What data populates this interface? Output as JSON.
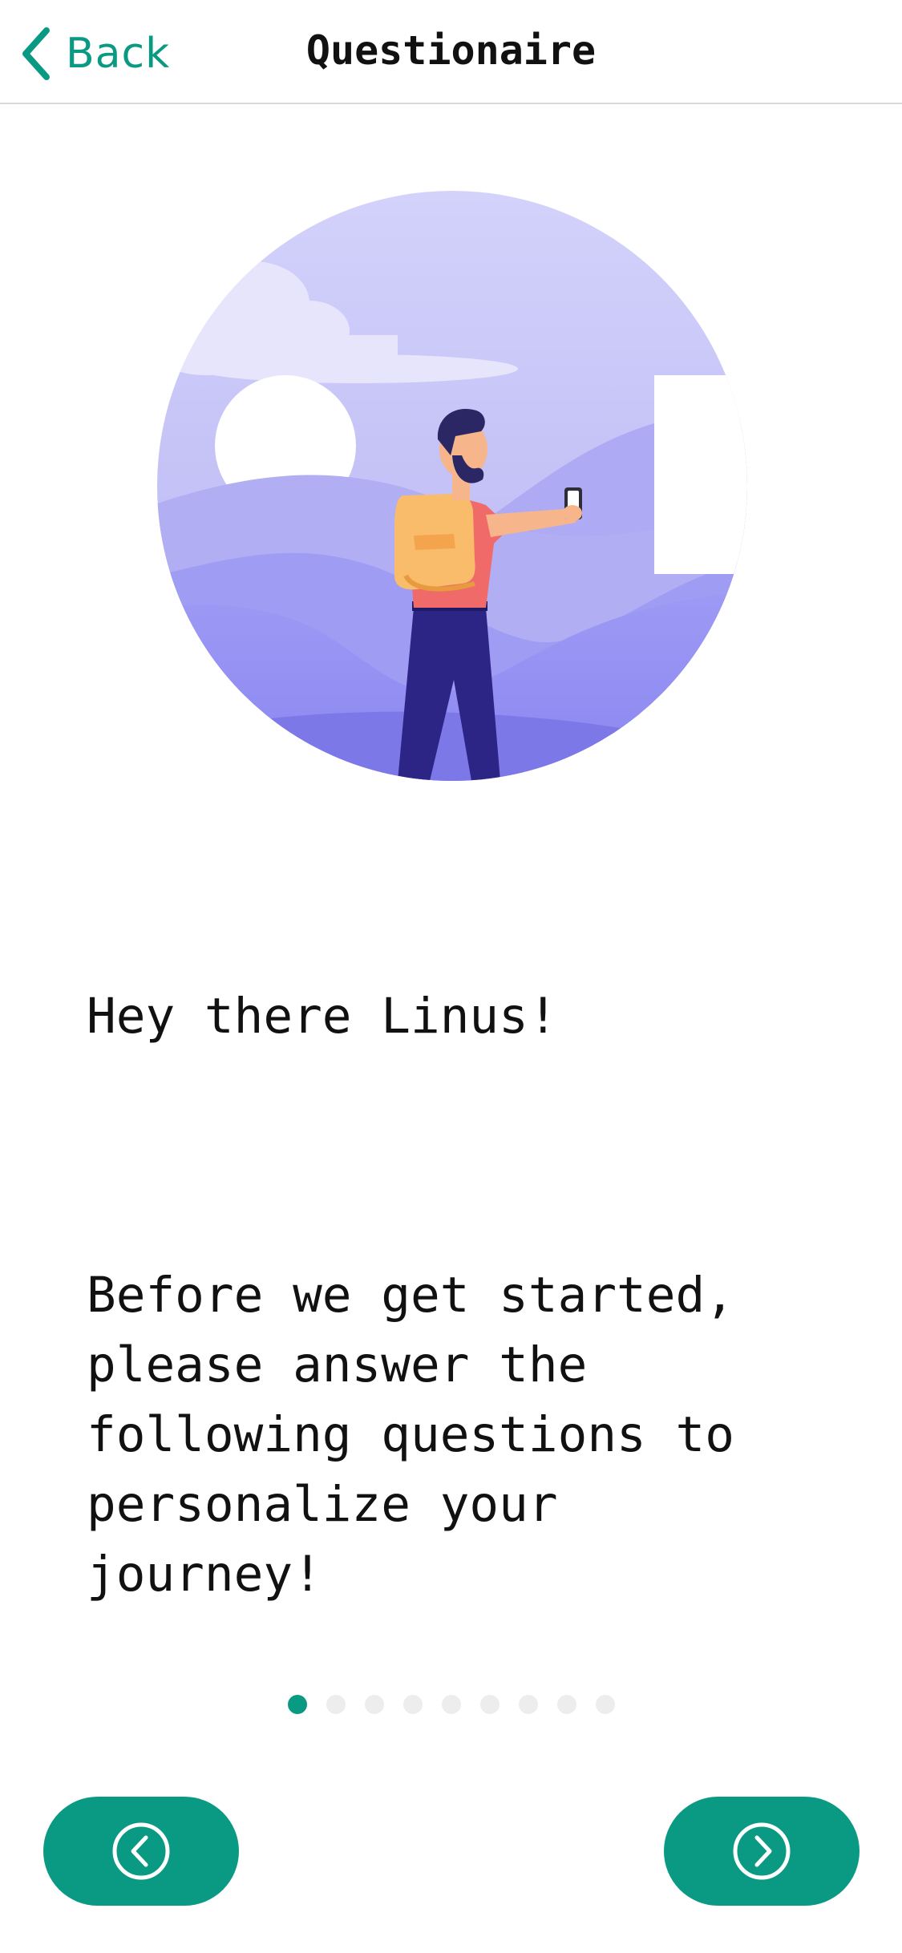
{
  "header": {
    "back_label": "Back",
    "title": "Questionaire"
  },
  "illustration": {
    "icon": "hiker-with-phone-illustration"
  },
  "message": {
    "greeting": "Hey there Linus!",
    "body": "Before we get started,\nplease answer the\nfollowing questions to\npersonalize your\njourney!"
  },
  "pager": {
    "total_pages": 9,
    "current_page": 1
  },
  "footer": {
    "prev_icon": "chevron-left-circle-icon",
    "next_icon": "chevron-right-circle-icon"
  },
  "colors": {
    "accent": "#0a9a83",
    "dot_inactive": "#ededed",
    "text": "#111111"
  }
}
